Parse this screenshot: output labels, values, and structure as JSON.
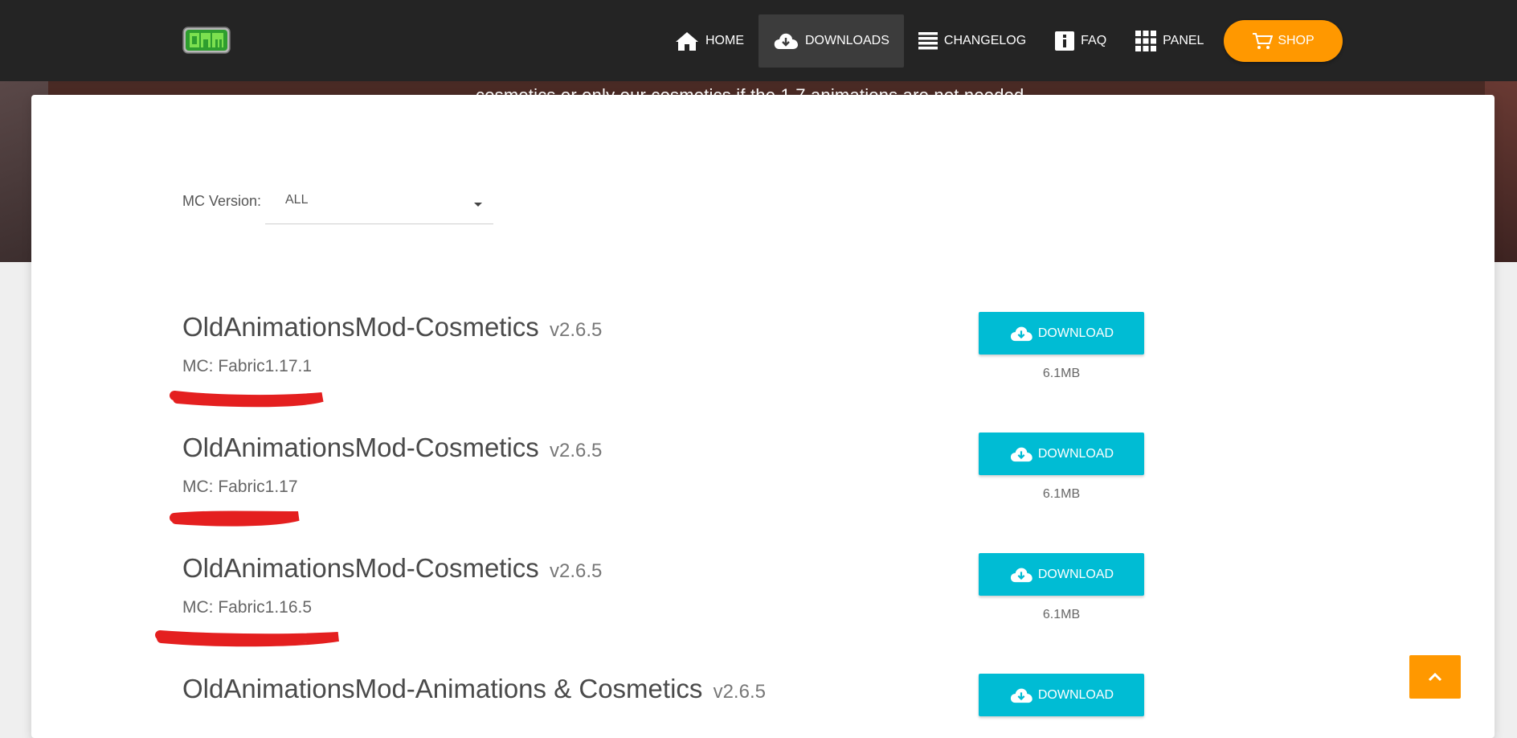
{
  "hero": {
    "subtitle": "cosmetics or only our cosmetics if the 1.7 animations are not needed"
  },
  "nav": {
    "logo_text": "OAM",
    "items": [
      {
        "label": "HOME",
        "icon": "home-icon"
      },
      {
        "label": "DOWNLOADS",
        "icon": "cloud-download-icon",
        "active": true
      },
      {
        "label": "CHANGELOG",
        "icon": "list-icon"
      },
      {
        "label": "FAQ",
        "icon": "info-icon"
      },
      {
        "label": "PANEL",
        "icon": "grid-icon"
      }
    ],
    "shop_label": "SHOP"
  },
  "filter": {
    "label": "MC Version:",
    "selected": "ALL"
  },
  "downloads": [
    {
      "name": "OldAnimationsMod-Cosmetics",
      "version": "v2.6.5",
      "mc": "MC: Fabric1.17.1",
      "button": "DOWNLOAD",
      "size": "6.1MB"
    },
    {
      "name": "OldAnimationsMod-Cosmetics",
      "version": "v2.6.5",
      "mc": "MC: Fabric1.17",
      "button": "DOWNLOAD",
      "size": "6.1MB"
    },
    {
      "name": "OldAnimationsMod-Cosmetics",
      "version": "v2.6.5",
      "mc": "MC: Fabric1.16.5",
      "button": "DOWNLOAD",
      "size": "6.1MB"
    },
    {
      "name": "OldAnimationsMod-Animations & Cosmetics",
      "version": "v2.6.5",
      "mc": "",
      "button": "DOWNLOAD",
      "size": ""
    }
  ],
  "colors": {
    "navbar": "#242424",
    "accent_cyan": "#00bcd4",
    "accent_orange": "#ff9800",
    "annotation_red": "#e41f1f"
  }
}
